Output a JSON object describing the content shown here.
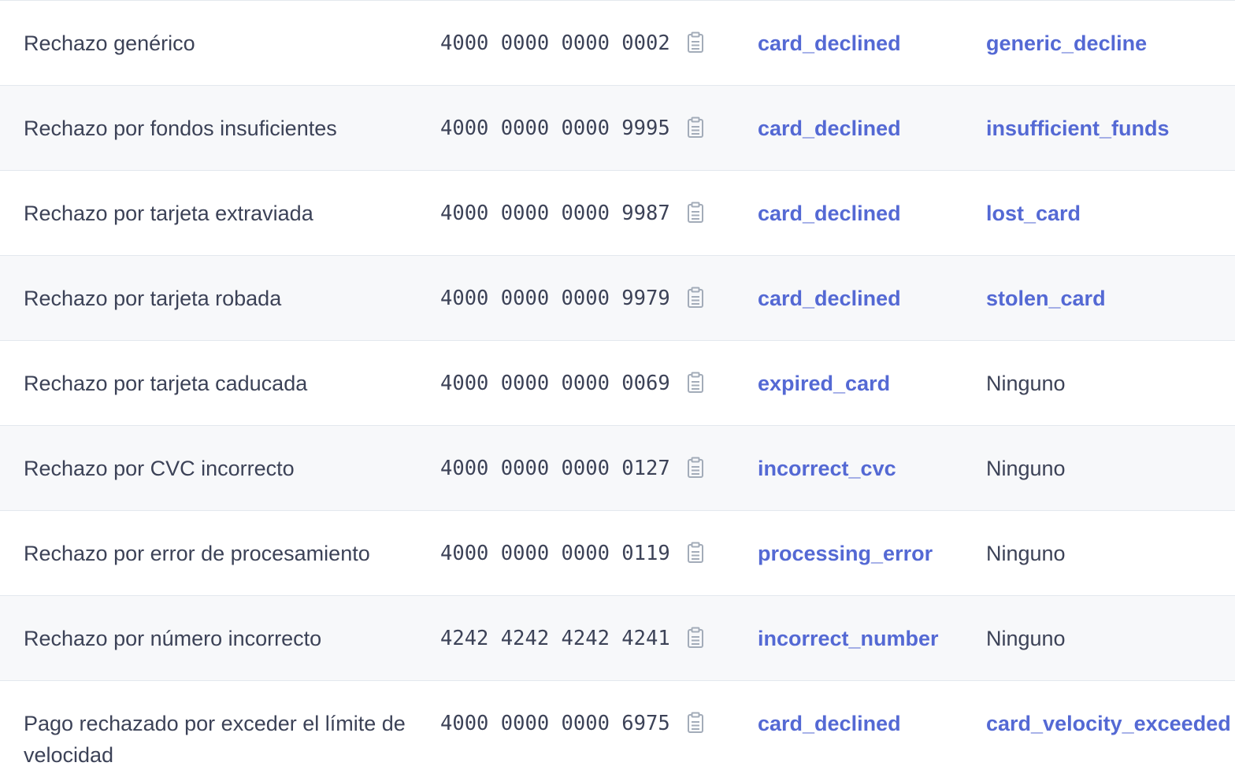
{
  "rows": [
    {
      "description": "Rechazo genérico",
      "number": "4000 0000 0000 0002",
      "error_code": "card_declined",
      "decline_code": "generic_decline",
      "decline_is_link": true
    },
    {
      "description": "Rechazo por fondos insuficientes",
      "number": "4000 0000 0000 9995",
      "error_code": "card_declined",
      "decline_code": "insufficient_funds",
      "decline_is_link": true
    },
    {
      "description": "Rechazo por tarjeta extraviada",
      "number": "4000 0000 0000 9987",
      "error_code": "card_declined",
      "decline_code": "lost_card",
      "decline_is_link": true
    },
    {
      "description": "Rechazo por tarjeta robada",
      "number": "4000 0000 0000 9979",
      "error_code": "card_declined",
      "decline_code": "stolen_card",
      "decline_is_link": true
    },
    {
      "description": "Rechazo por tarjeta caducada",
      "number": "4000 0000 0000 0069",
      "error_code": "expired_card",
      "decline_code": "Ninguno",
      "decline_is_link": false
    },
    {
      "description": "Rechazo por CVC incorrecto",
      "number": "4000 0000 0000 0127",
      "error_code": "incorrect_cvc",
      "decline_code": "Ninguno",
      "decline_is_link": false
    },
    {
      "description": "Rechazo por error de procesamiento",
      "number": "4000 0000 0000 0119",
      "error_code": "processing_error",
      "decline_code": "Ninguno",
      "decline_is_link": false
    },
    {
      "description": "Rechazo por número incorrecto",
      "number": "4242 4242 4242 4241",
      "error_code": "incorrect_number",
      "decline_code": "Ninguno",
      "decline_is_link": false
    },
    {
      "description": "Pago rechazado por exceder el límite de velocidad",
      "number": "4000 0000 0000 6975",
      "error_code": "card_declined",
      "decline_code": "card_velocity_exceeded",
      "decline_is_link": true
    }
  ],
  "icons": {
    "copy": "clipboard-icon"
  },
  "colors": {
    "link": "#5469d4",
    "text": "#3c4257",
    "alt_row": "#f7f8fa",
    "border": "#e3e8ee"
  }
}
